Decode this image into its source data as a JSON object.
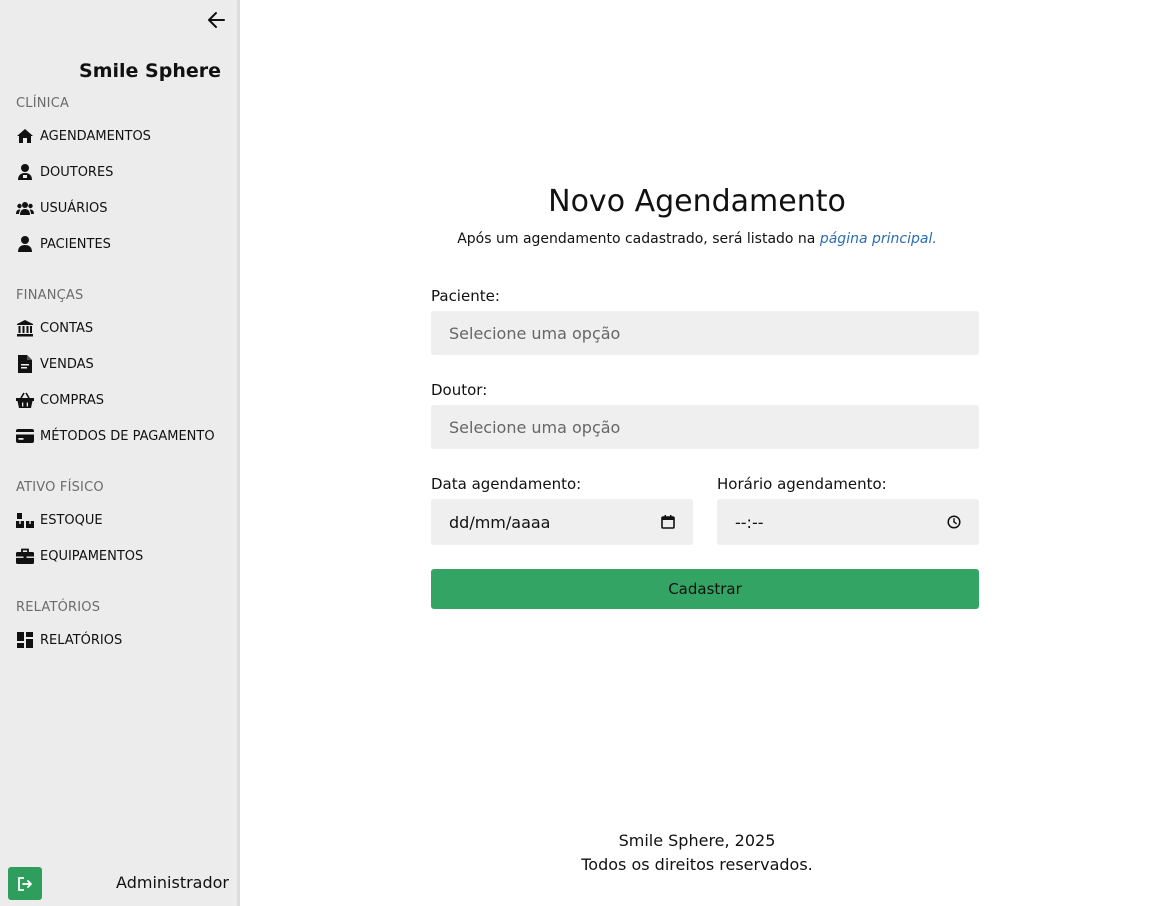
{
  "sidebar": {
    "brand": "Smile Sphere",
    "sections": [
      {
        "label": "CLÍNICA",
        "items": [
          {
            "label": "AGENDAMENTOS",
            "icon": "home-icon"
          },
          {
            "label": "DOUTORES",
            "icon": "doctor-icon"
          },
          {
            "label": "USUÁRIOS",
            "icon": "users-icon"
          },
          {
            "label": "PACIENTES",
            "icon": "user-icon"
          }
        ]
      },
      {
        "label": "FINANÇAS",
        "items": [
          {
            "label": "CONTAS",
            "icon": "bank-icon"
          },
          {
            "label": "VENDAS",
            "icon": "invoice-icon"
          },
          {
            "label": "COMPRAS",
            "icon": "basket-icon"
          },
          {
            "label": "MÉTODOS DE PAGAMENTO",
            "icon": "credit-card-icon"
          }
        ]
      },
      {
        "label": "ATIVO FÍSICO",
        "items": [
          {
            "label": "ESTOQUE",
            "icon": "boxes-icon"
          },
          {
            "label": "EQUIPAMENTOS",
            "icon": "toolbox-icon"
          }
        ]
      },
      {
        "label": "RELATÓRIOS",
        "items": [
          {
            "label": "RELATÓRIOS",
            "icon": "dashboard-icon"
          }
        ]
      }
    ],
    "user_name": "Administrador"
  },
  "main": {
    "title": "Novo Agendamento",
    "subtitle_prefix": "Após um agendamento cadastrado, será listado na ",
    "subtitle_link": "página principal.",
    "form": {
      "patient_label": "Paciente:",
      "patient_placeholder": "Selecione uma opção",
      "doctor_label": "Doutor:",
      "doctor_placeholder": "Selecione uma opção",
      "date_label": "Data agendamento:",
      "date_value": "dd/mm/aaaa",
      "time_label": "Horário agendamento:",
      "time_value": "--:--",
      "submit_label": "Cadastrar"
    }
  },
  "footer": {
    "brand": "Smile Sphere, 2025",
    "rights": "Todos os direitos reservados."
  },
  "colors": {
    "sidebar_bg": "#ececec",
    "accent_green": "#33a463",
    "link_blue": "#2b6cb0",
    "field_bg": "#efefef"
  }
}
